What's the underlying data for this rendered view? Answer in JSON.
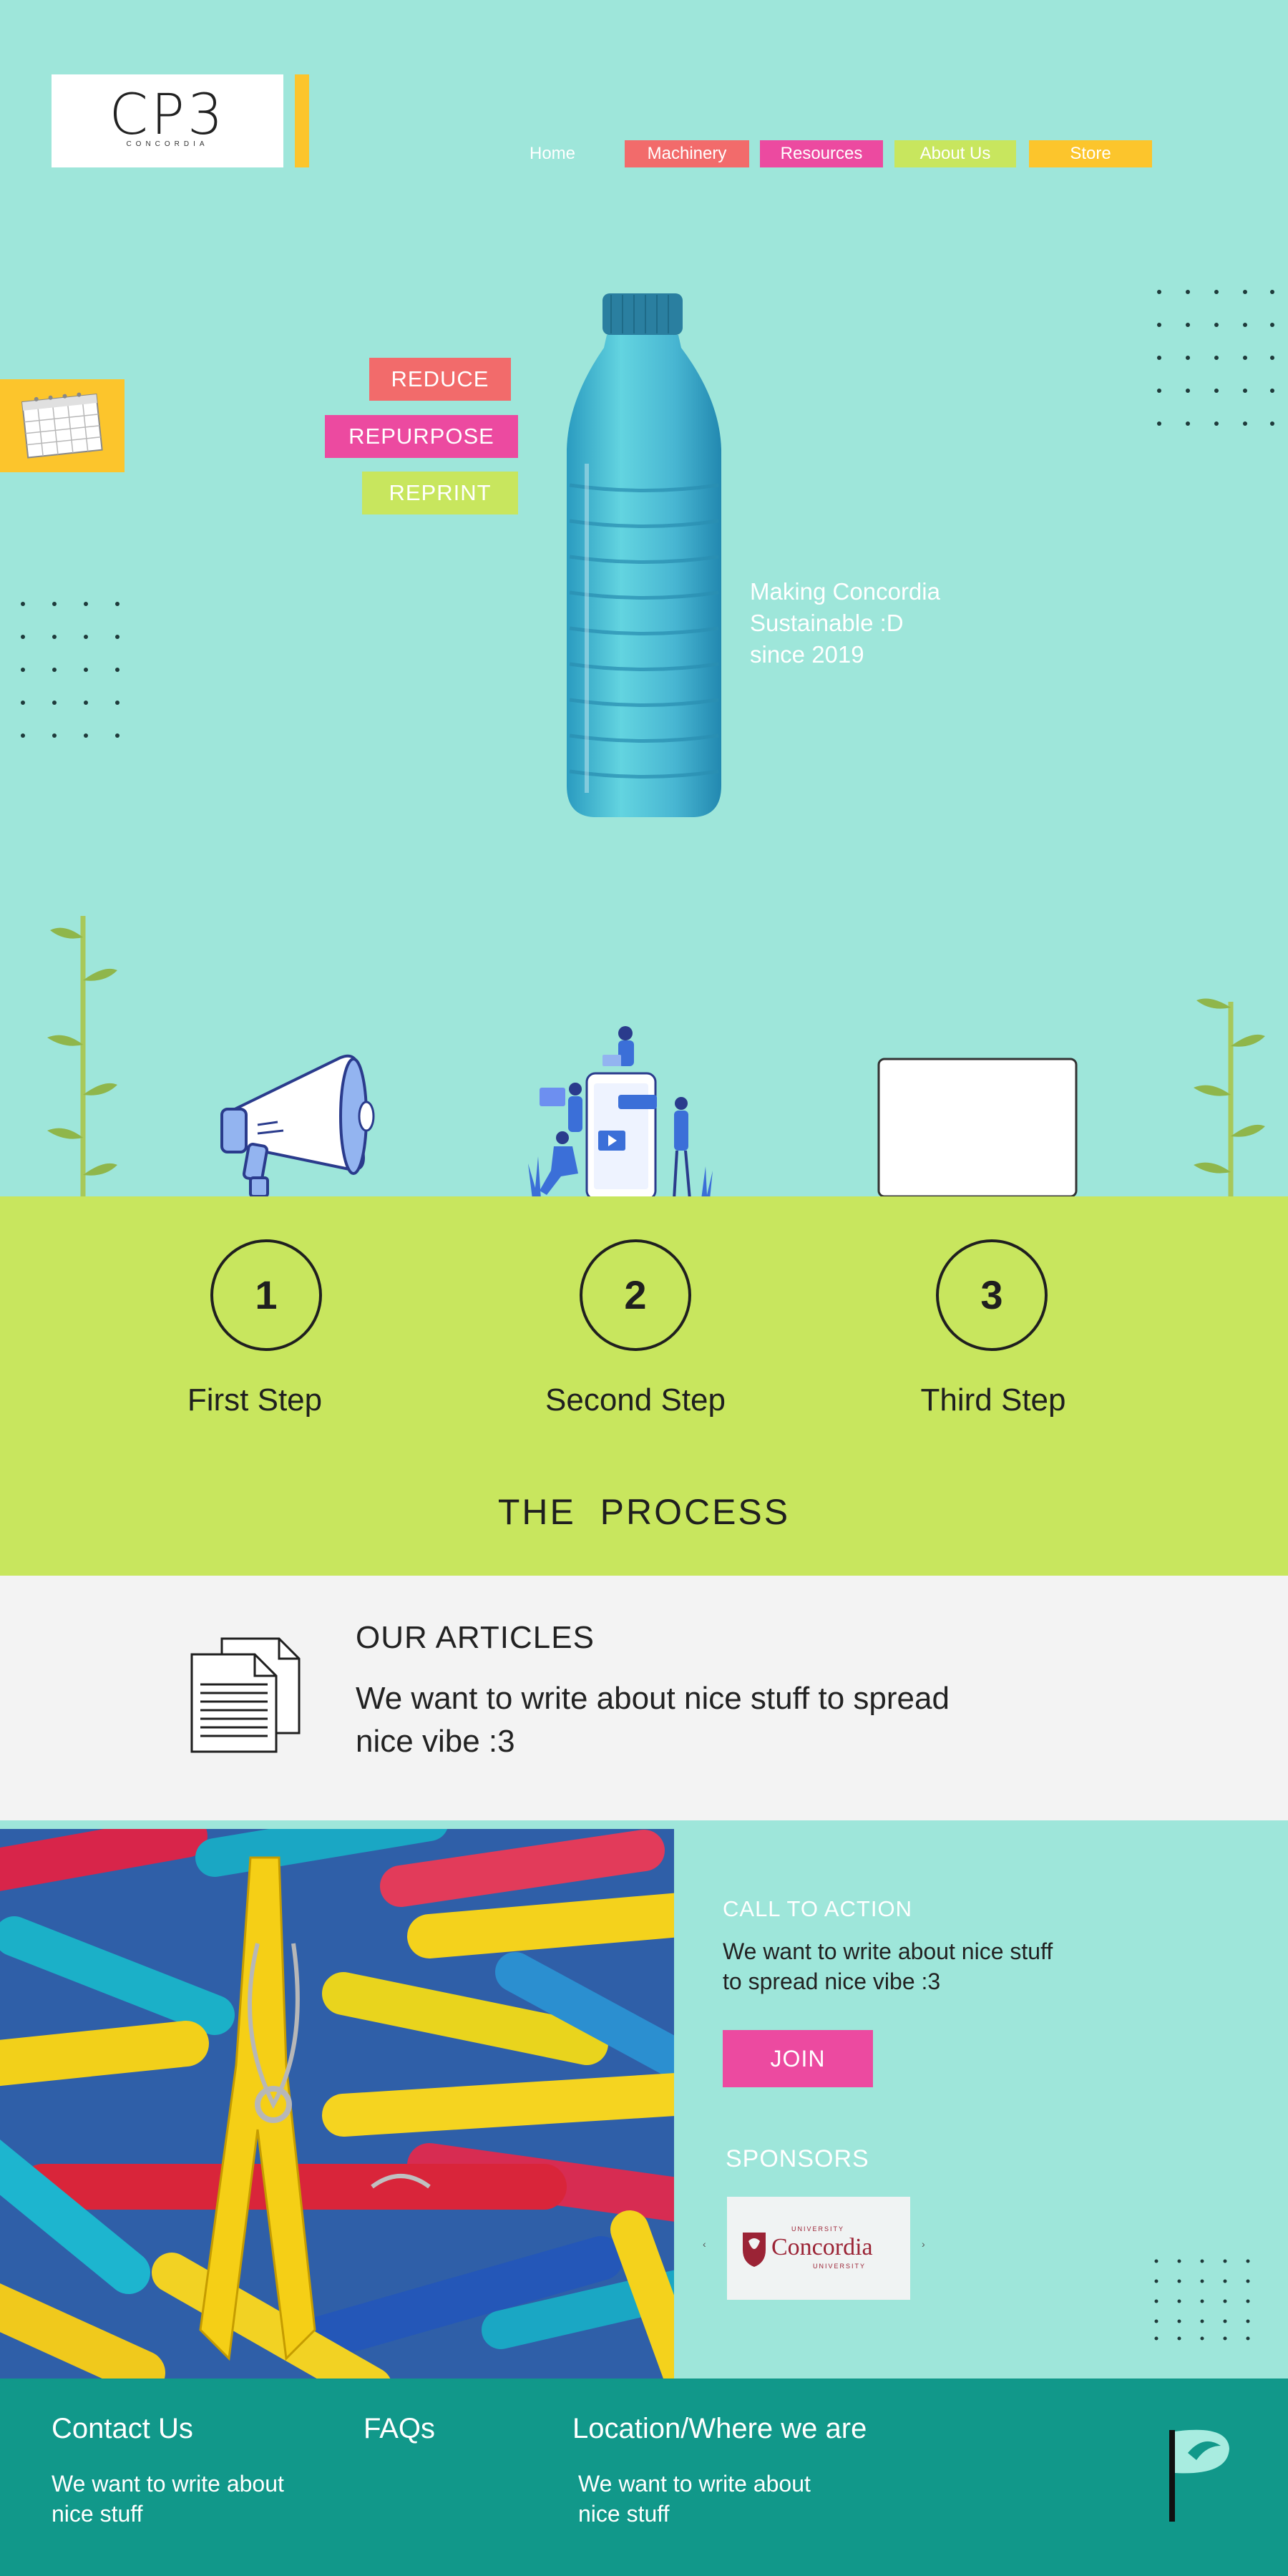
{
  "header": {
    "logo": {
      "mark": "CP3",
      "subtitle": "CONCORDIA"
    },
    "nav": [
      {
        "label": "Home"
      },
      {
        "label": "Machinery"
      },
      {
        "label": "Resources"
      },
      {
        "label": "About Us"
      },
      {
        "label": "Store"
      }
    ]
  },
  "hero": {
    "tags": [
      "REDUCE",
      "REPURPOSE",
      "REPRINT"
    ],
    "tagline": [
      "Making Concordia",
      "Sustainable :D",
      "since 2019"
    ]
  },
  "process": {
    "title": "THE  PROCESS",
    "steps": [
      {
        "number": "1",
        "label": "First Step"
      },
      {
        "number": "2",
        "label": "Second Step"
      },
      {
        "number": "3",
        "label": "Third Step"
      }
    ]
  },
  "articles": {
    "title": "OUR ARTICLES",
    "body": "We want to write about nice stuff to spread nice vibe :3"
  },
  "call_to_action": {
    "title": "CALL TO ACTION",
    "body": "We want to write about nice stuff to spread nice vibe :3",
    "button": "JOIN"
  },
  "sponsors": {
    "title": "SPONSORS",
    "items": [
      {
        "top": "UNIVERSITY",
        "name": "Concordia",
        "bottom": "UNIVERSITY"
      }
    ],
    "prev": "‹",
    "next": "›"
  },
  "footer": {
    "contact": {
      "title": "Contact Us",
      "body": "We want to write about nice stuff"
    },
    "faqs": {
      "title": "FAQs"
    },
    "location": {
      "title": "Location/Where we are",
      "body": "We want to write about nice stuff"
    }
  },
  "colors": {
    "background": "#9ee6da",
    "coral": "#f26b6b",
    "pink": "#ec4aa0",
    "lime": "#c8e65e",
    "yellow": "#fcc52c",
    "footer": "#11988a",
    "light_gray": "#f3f3f3"
  },
  "icons": [
    "calendar-icon",
    "megaphone-icon",
    "social-media-illustration",
    "laptop-icon",
    "document-stack-icon",
    "plant-icon",
    "cp3-logo-icon"
  ]
}
